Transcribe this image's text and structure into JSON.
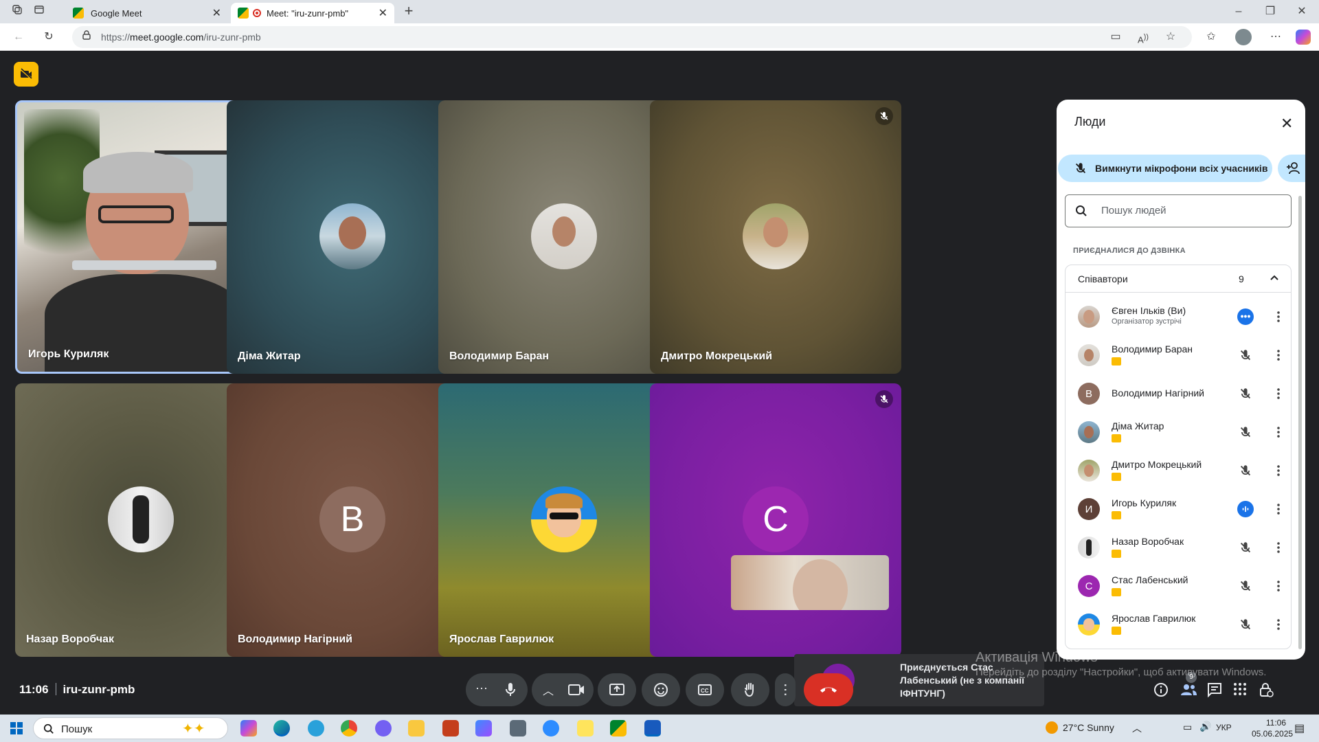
{
  "browser": {
    "tabs": [
      {
        "title": "Google Meet"
      },
      {
        "title": "Meet: \"iru-zunr-pmb\""
      }
    ],
    "url_prefix": "https://",
    "url_host": "meet.google.com",
    "url_path": "/iru-zunr-pmb"
  },
  "meeting": {
    "time": "11:06",
    "code": "iru-zunr-pmb"
  },
  "tiles": [
    {
      "name": "Игорь Куриляк",
      "speaking": true
    },
    {
      "name": "Діма Житар"
    },
    {
      "name": "Володимир Баран"
    },
    {
      "name": "Дмитро Мокрецький"
    },
    {
      "name": "Назар Воробчак"
    },
    {
      "name": "Володимир Нагірний",
      "letter": "В"
    },
    {
      "name": "Ярослав Гаврилюк"
    },
    {
      "name": "",
      "letter": "С"
    }
  ],
  "people_panel": {
    "title": "Люди",
    "mute_all_label": "Вимкнути мікрофони всіх учасників",
    "search_placeholder": "Пошук людей",
    "joined_heading": "ПРИЄДНАЛИСЯ ДО ДЗВІНКА",
    "group_title": "Співавтори",
    "group_count": "9",
    "participants": [
      {
        "name": "Євген Ільків (Ви)",
        "subtitle": "Організатор зустрічі"
      },
      {
        "name": "Володимир Баран"
      },
      {
        "name": "Володимир Нагірний",
        "letter": "В"
      },
      {
        "name": "Діма Житар"
      },
      {
        "name": "Дмитро Мокрецький"
      },
      {
        "name": "Игорь Куриляк",
        "letter": "И"
      },
      {
        "name": "Назар Воробчак"
      },
      {
        "name": "Стас Лабенський",
        "letter": "С"
      },
      {
        "name": "Ярослав Гаврилюк"
      }
    ]
  },
  "toast": {
    "letter": "С",
    "text": "Приєднується Стас Лабенський (не з компанії ІФНТУНГ)"
  },
  "controls": {
    "people_badge": "9"
  },
  "watermark": {
    "line1": "Активація Windows",
    "line2": "Перейдіть до розділу \"Настройки\", щоб активувати Windows."
  },
  "taskbar": {
    "search_label": "Пошук",
    "weather": "27°C  Sunny",
    "lang": "УКР",
    "time": "11:06",
    "date": "05.06.2025"
  },
  "colors": {
    "meet_bg": "#202124",
    "accent_blue": "#c2e7ff",
    "hangup": "#d93025",
    "recording": "#fbbc04"
  }
}
